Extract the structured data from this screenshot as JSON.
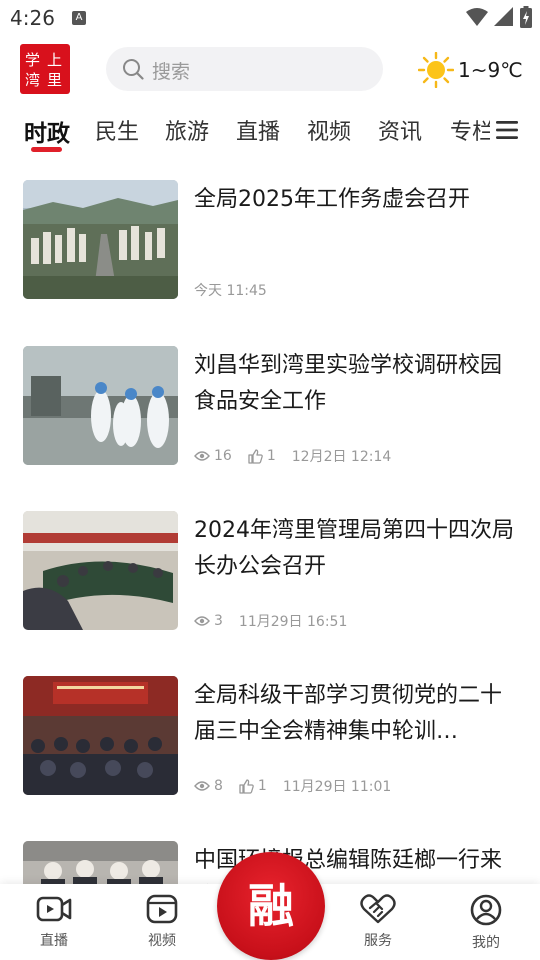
{
  "status_bar": {
    "time": "4:26",
    "notification_letter": "A"
  },
  "header": {
    "logo_chars": [
      "学",
      "上",
      "湾",
      "里"
    ],
    "search": {
      "placeholder": "搜索"
    },
    "weather": {
      "icon": "sun-icon",
      "temperature": "1~9℃"
    }
  },
  "tabs": {
    "items": [
      "时政",
      "民生",
      "旅游",
      "直播",
      "视频",
      "资讯",
      "专栏"
    ],
    "active": "时政",
    "accent_color": "#e0202a"
  },
  "feed": {
    "items": [
      {
        "title": "全局2025年工作务虚会召开",
        "views": "",
        "likes": "",
        "time": "今天 11:45",
        "thumbnail": "aerial-city-view"
      },
      {
        "title": "刘昌华到湾里实验学校调研校园食品安全工作",
        "views": "16",
        "likes": "1",
        "time": "12月2日 12:14",
        "thumbnail": "kitchen-inspection"
      },
      {
        "title": "2024年湾里管理局第四十四次局长办公会召开",
        "views": "3",
        "likes": "",
        "time": "11月29日 16:51",
        "thumbnail": "meeting-room"
      },
      {
        "title": "全局科级干部学习贯彻党的二十届三中全会精神集中轮训…",
        "views": "8",
        "likes": "1",
        "time": "11月29日 11:01",
        "thumbnail": "auditorium"
      },
      {
        "title": "中国环境报总编辑陈廷榔一行来湾里调研采访",
        "views": "",
        "likes": "",
        "time": "",
        "thumbnail": "group-visit"
      }
    ]
  },
  "bottom_nav": {
    "items": [
      {
        "label": "直播",
        "icon": "live-camera-icon"
      },
      {
        "label": "视频",
        "icon": "video-play-icon"
      },
      {
        "label": "融",
        "icon": "rong-center-icon"
      },
      {
        "label": "服务",
        "icon": "handshake-heart-icon"
      },
      {
        "label": "我的",
        "icon": "user-profile-icon"
      }
    ],
    "brand_color": "#d8111c"
  }
}
